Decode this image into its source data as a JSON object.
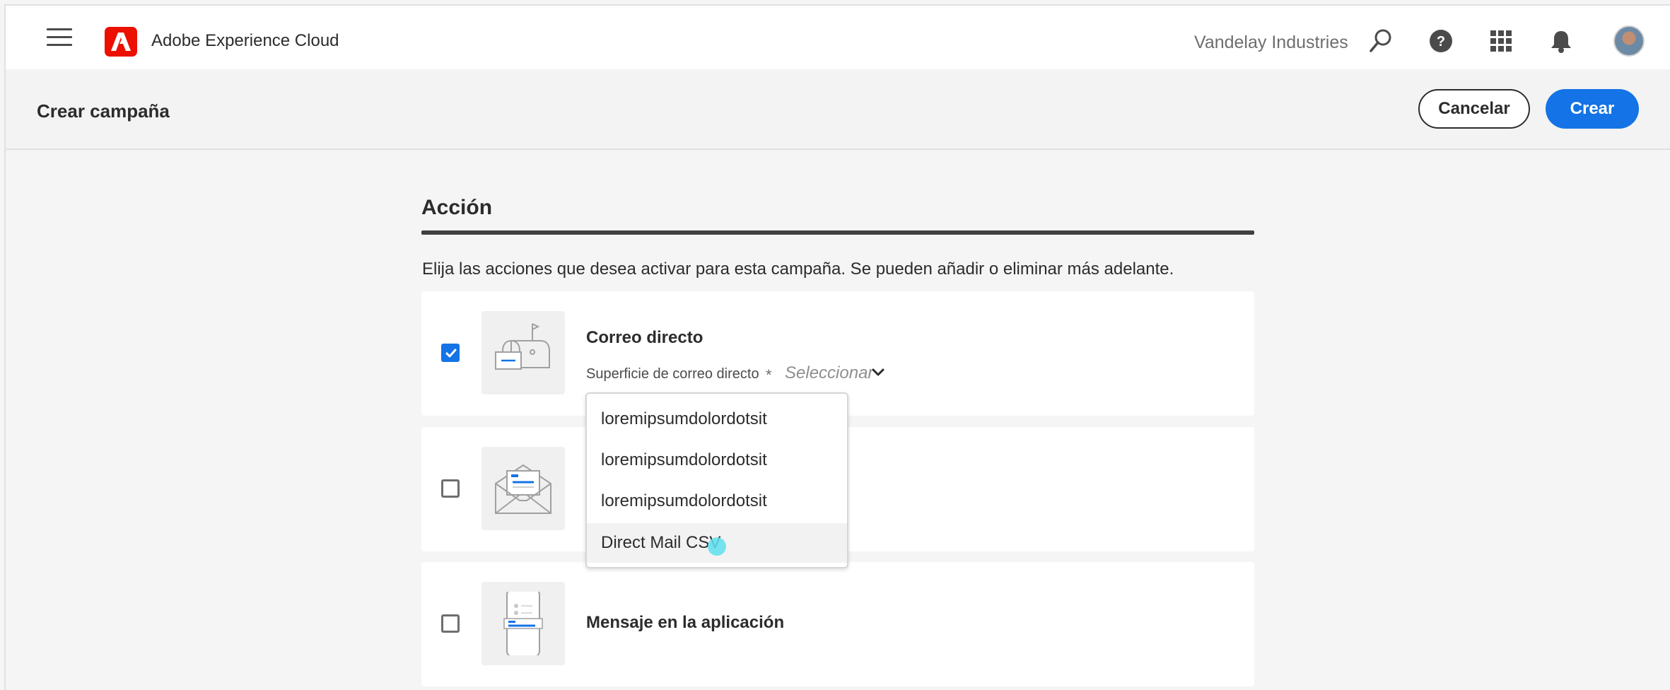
{
  "topbar": {
    "app_title": "Adobe Experience Cloud",
    "org_name": "Vandelay Industries",
    "icons": [
      "menu-icon",
      "adobe-logo",
      "search-icon",
      "help-icon",
      "apps-grid-icon",
      "bell-icon",
      "avatar"
    ]
  },
  "header": {
    "title": "Crear campaña",
    "cancel_label": "Cancelar",
    "create_label": "Crear"
  },
  "section": {
    "title": "Acción",
    "description": "Elija las acciones que desea activar para esta campaña. Se pueden añadir o eliminar más adelante."
  },
  "actions": [
    {
      "title": "Correo directo",
      "checked": true,
      "field_label": "Superficie de correo directo",
      "required_mark": "*",
      "select_placeholder": "Seleccionar",
      "icon": "mailbox-icon"
    },
    {
      "title": "",
      "checked": false,
      "icon": "email-envelope-icon"
    },
    {
      "title": "Mensaje en la aplicación",
      "checked": false,
      "icon": "mobile-app-icon"
    }
  ],
  "dropdown": {
    "options": [
      "loremipsumdolordotsit",
      "loremipsumdolordotsit",
      "loremipsumdolordotsit",
      "Direct Mail CSV"
    ],
    "hovered": "Direct Mail CSV"
  },
  "colors": {
    "accent": "#1473e6",
    "adobe_red": "#eb1000",
    "background": "#f5f5f5"
  }
}
